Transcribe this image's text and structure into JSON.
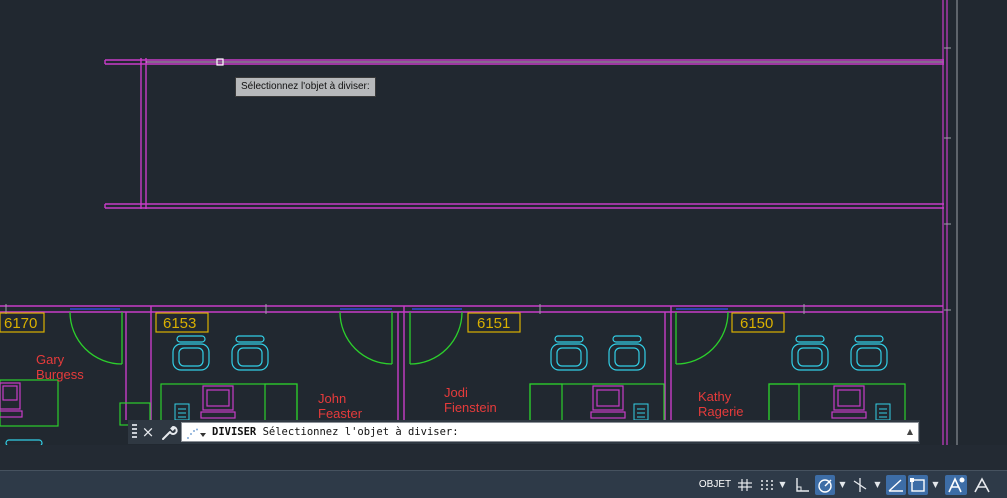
{
  "tooltip": {
    "text": "Sélectionnez l'objet à diviser:"
  },
  "rooms": [
    {
      "number": "6170"
    },
    {
      "number": "6153"
    },
    {
      "number": "6151"
    },
    {
      "number": "6150"
    }
  ],
  "occupants": [
    {
      "first": "Gary",
      "last": "Burgess"
    },
    {
      "first": "John",
      "last": "Feaster"
    },
    {
      "first": "Jodi",
      "last": "Fienstein"
    },
    {
      "first": "Kathy",
      "last": "Ragerie"
    }
  ],
  "command_line": {
    "close_icon": "×",
    "command": "DIVISER",
    "prompt": " Sélectionnez l'objet à diviser:"
  },
  "status_bar": {
    "model_space_label": "OBJET",
    "icons": [
      "grid-icon",
      "snap-icon",
      "ortho-icon",
      "polar-icon",
      "isodraft-icon",
      "osnap-tracking-icon",
      "osnap-icon",
      "annotation-scale-icon",
      "annotation-visibility-icon"
    ]
  },
  "colors": {
    "background": "#212830",
    "walls": "#c83cc8",
    "doors": "#2ccf2c",
    "furniture": "#32cfe6",
    "labels": "#e63b3b",
    "room_tags": "#d9b000",
    "active_toggle": "#3d6da6"
  }
}
